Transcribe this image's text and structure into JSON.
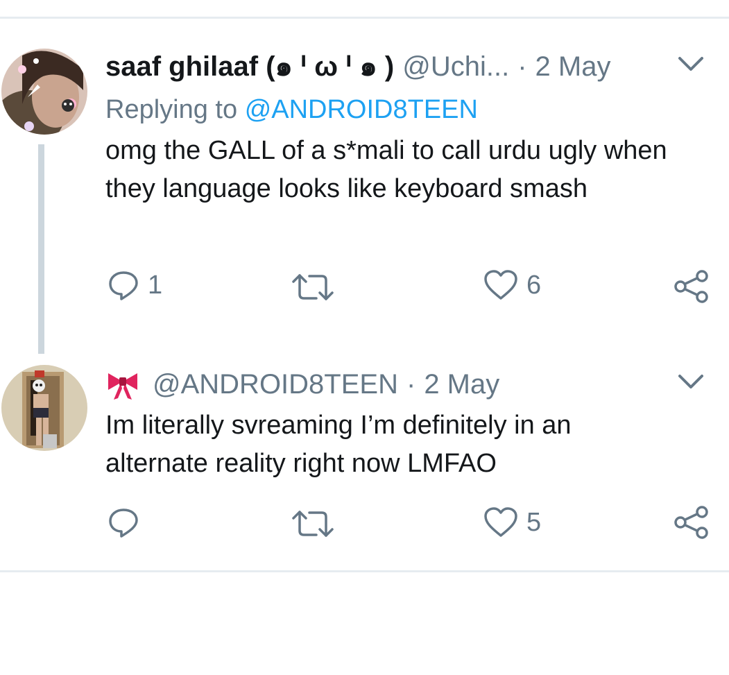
{
  "tweets": [
    {
      "display_name": "saaf ghilaaf (๑ ᑊ ω ᑊ ๑ )",
      "handle": "@Uchi...",
      "separator": "·",
      "time": "2 May",
      "reply_prefix": "Replying to",
      "reply_mention": "@ANDROID8TEEN",
      "text": "omg the GALL of a s*mali to call urdu ugly when they language looks like keyboard smash",
      "reply_count": "1",
      "retweet_count": "",
      "like_count": "6"
    },
    {
      "display_name": "",
      "handle": "@ANDROID8TEEN",
      "separator": "·",
      "time": "2 May",
      "text": "Im literally svreaming I’m definitely in an alternate reality right now LMFAO",
      "reply_count": "",
      "retweet_count": "",
      "like_count": "5"
    }
  ],
  "icons": {
    "reply": "reply-icon",
    "retweet": "retweet-icon",
    "like": "heart-icon",
    "share": "share-icon",
    "caret": "chevron-down-icon",
    "ribbon": "red-bow-emoji"
  },
  "colors": {
    "text": "#14171a",
    "secondary": "#657786",
    "link": "#1da1f2",
    "thread_line": "#ccd6dd",
    "divider": "#e6ecf0",
    "bow": "#e0245e"
  }
}
